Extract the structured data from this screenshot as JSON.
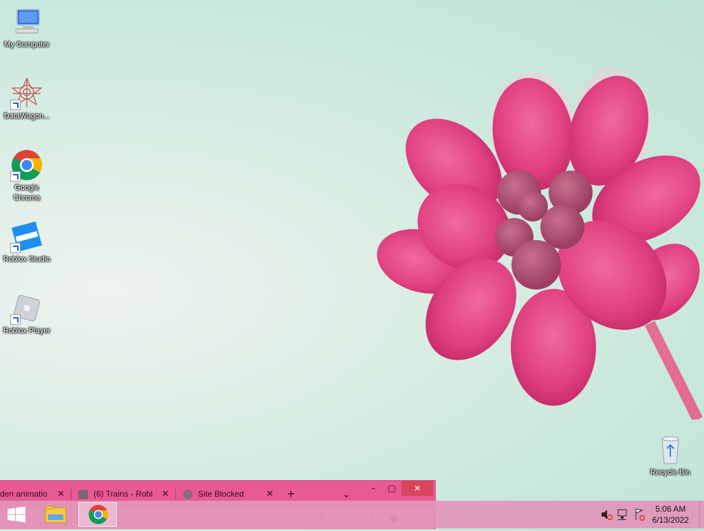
{
  "desktop": {
    "icons": [
      {
        "label": "My Computer"
      },
      {
        "label": "DataWagon..."
      },
      {
        "label": "Google Chrome"
      },
      {
        "label": "Roblox Studio"
      },
      {
        "label": "Roblox Player"
      },
      {
        "label": "Recycle Bin"
      }
    ]
  },
  "chrome": {
    "tabs": [
      {
        "title": "den animatio"
      },
      {
        "title": "(6) Trains - Robl"
      },
      {
        "title": "Site Blocked"
      }
    ],
    "new_tab": "+",
    "tab_search": "⌄",
    "controls": {
      "minimize": "–",
      "maximize": "□",
      "close": "✕"
    },
    "tab_close": "✕"
  },
  "taskbar": {
    "clock_time": "5:06 AM",
    "clock_date": "6/13/2022"
  },
  "colors": {
    "taskbar": "#e296ba",
    "chrome_frame": "#e85a93",
    "flower": "#e0407f"
  }
}
